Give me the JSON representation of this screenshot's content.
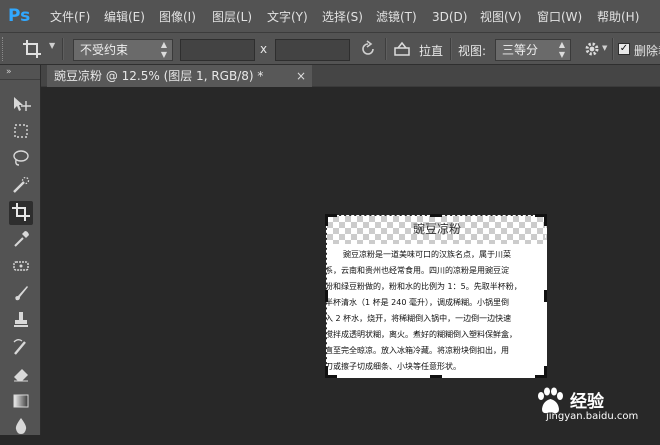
{
  "app": {
    "logo": "Ps"
  },
  "menu": [
    "文件(F)",
    "编辑(E)",
    "图像(I)",
    "图层(L)",
    "文字(Y)",
    "选择(S)",
    "滤镜(T)",
    "3D(D)",
    "视图(V)",
    "窗口(W)",
    "帮助(H)"
  ],
  "options": {
    "ratio_value": "不受约束",
    "x_label": "x",
    "straighten_label": "拉直",
    "view_label": "视图:",
    "view_value": "三等分",
    "delete_label": "删除裁"
  },
  "tab": {
    "title": "豌豆凉粉 @ 12.5% (图层 1, RGB/8) *",
    "close": "×"
  },
  "document": {
    "title": "豌豆凉粉",
    "lines": [
      "　　豌豆凉粉是一道美味可口的汉族名点，属于川菜",
      "系，云南和贵州也经常食用。四川的凉粉是用豌豆淀",
      "粉和绿豆粉做的，粉和水的比例为 1：5。先取半杯粉，",
      "半杯清水（1 杯是 240 毫升），调成稀糊。小锅里倒",
      "入 2 杯水，烧开，将稀糊倒入锅中，一边倒一边快速",
      "搅拌成透明状糊，离火。煮好的糊糊倒入塑料保鲜盒，",
      "直至完全晾凉。放入冰箱冷藏。将凉粉块倒扣出，用",
      "刀或擦子切成细条、小块等任意形状。"
    ]
  },
  "watermark": {
    "brand": "经验",
    "url": "jingyan.baidu.com"
  },
  "colors": {
    "chrome": "#535353",
    "canvas": "#282828",
    "ps_blue": "#31a8ff"
  }
}
